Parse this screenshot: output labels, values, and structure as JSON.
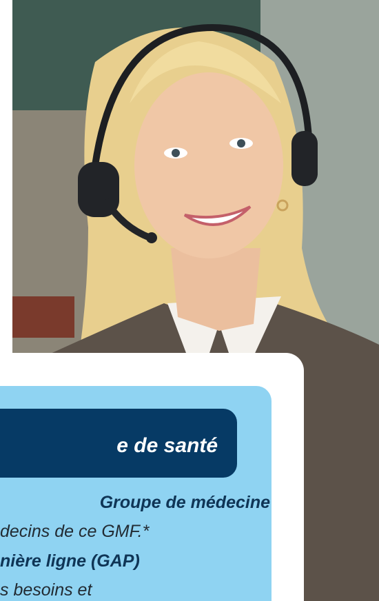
{
  "photo": {
    "subject": "smiling-woman-with-headset"
  },
  "card": {
    "banner_title": "e de santé",
    "lines": [
      "Groupe de médecine",
      "decins de ce GMF.*",
      "nière ligne (GAP)",
      "s besoins et"
    ]
  },
  "colors": {
    "card_bg": "#8fd3f2",
    "banner_bg": "#063a65",
    "text_dark": "#0f3556"
  }
}
